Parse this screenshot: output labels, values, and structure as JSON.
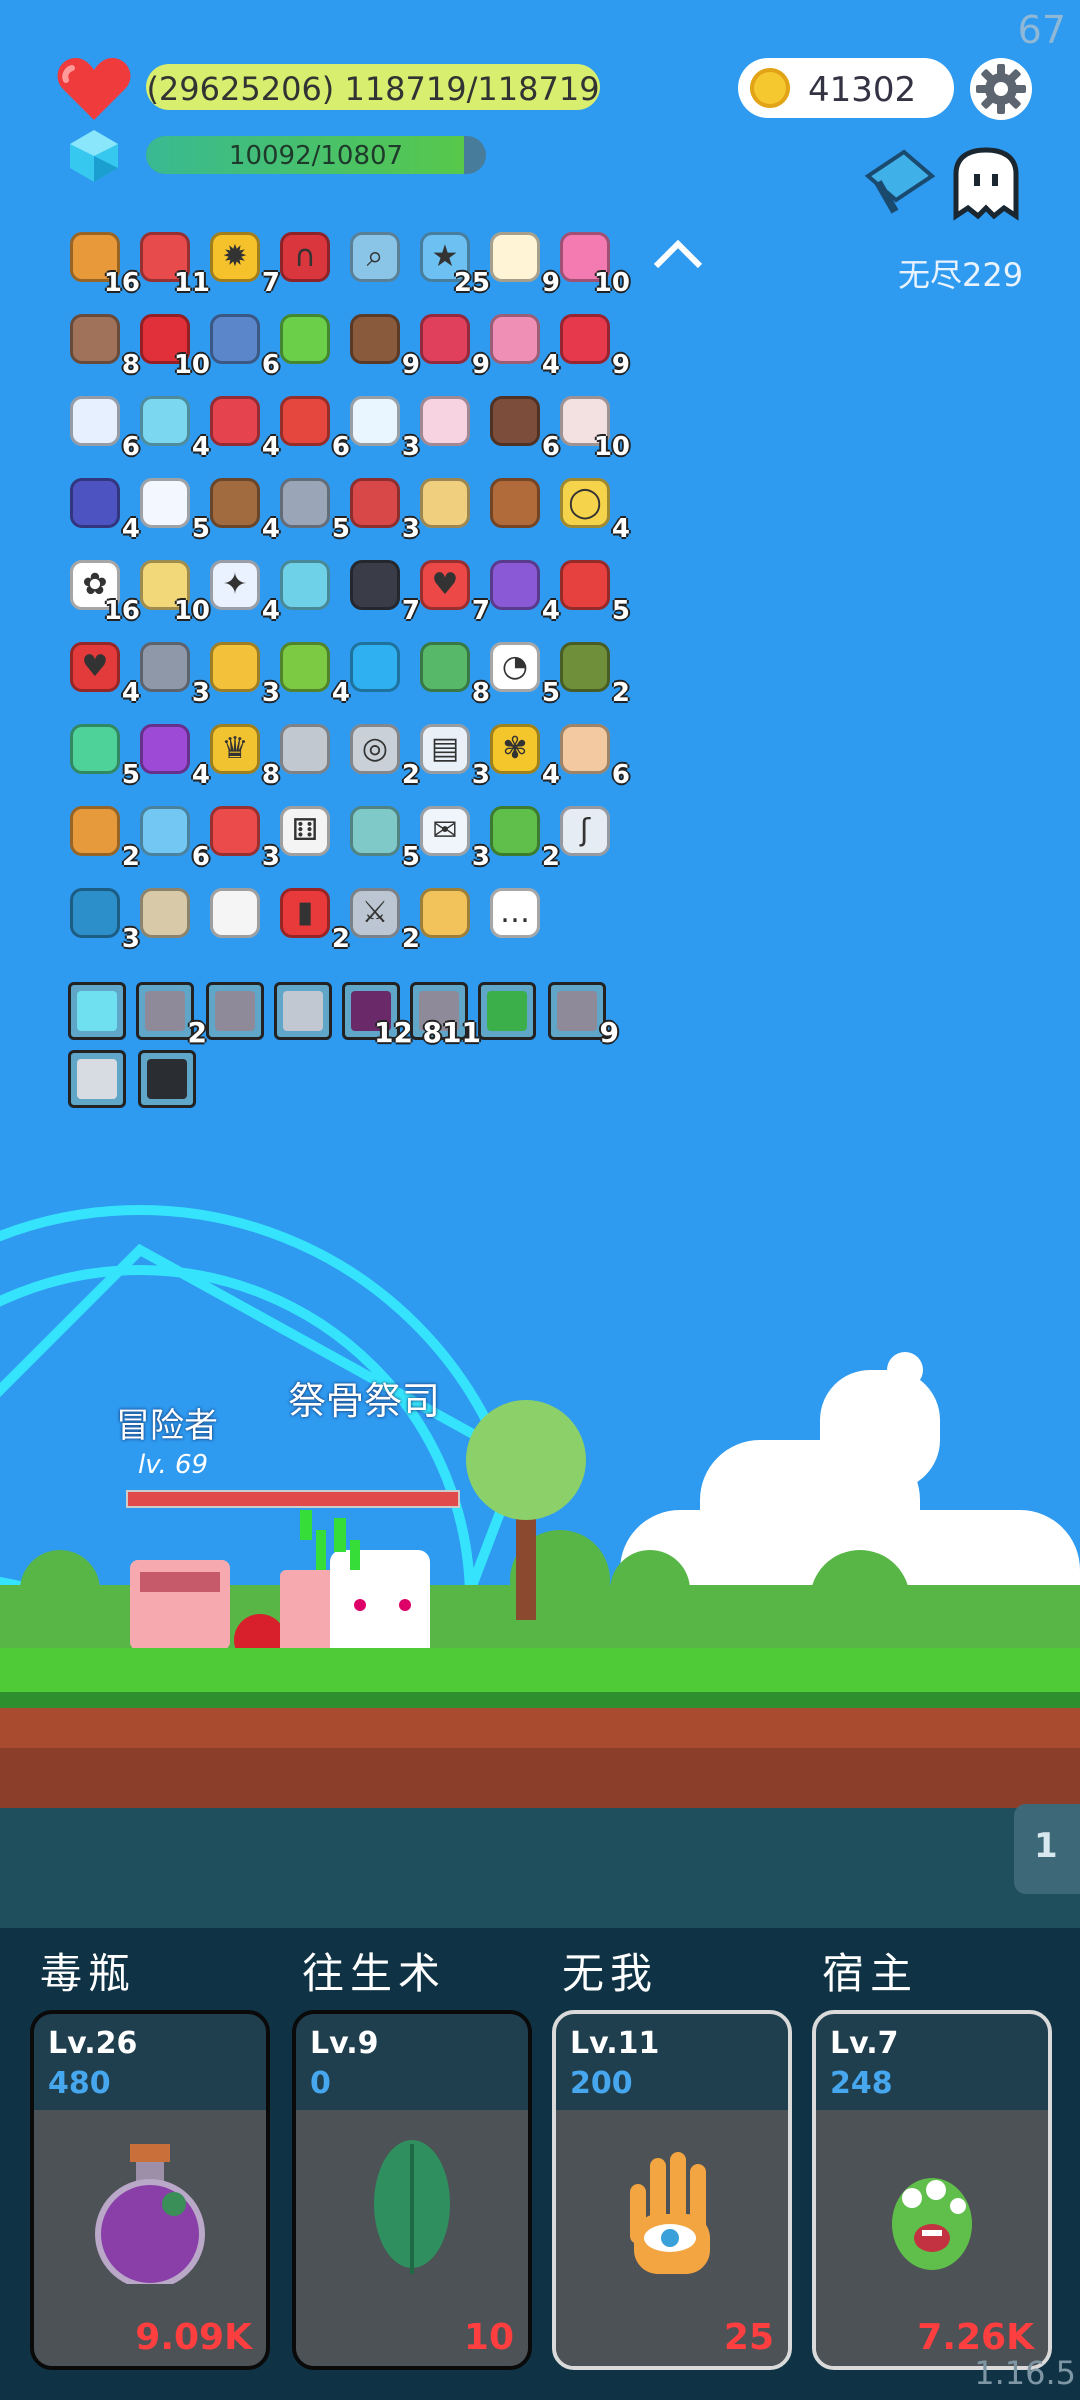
{
  "status": {
    "fps": "67",
    "hp_text": "(29625206) 118719/118719",
    "mp_text": "10092/10807",
    "mp_current": 10092,
    "mp_max": 10807
  },
  "currency": {
    "coins": "41302"
  },
  "mode": {
    "label": "无尽229"
  },
  "inventory": [
    {
      "icon": "book-icon",
      "color": "#e89a3b",
      "count": "16"
    },
    {
      "icon": "boot-icon",
      "color": "#e84b4b",
      "count": "11"
    },
    {
      "icon": "sun-icon",
      "color": "#f6c22b",
      "count": "7"
    },
    {
      "icon": "magnet-icon",
      "color": "#d9363e",
      "count": ""
    },
    {
      "icon": "magnifier-icon",
      "color": "#8ac5e8",
      "count": ""
    },
    {
      "icon": "star-card-icon",
      "color": "#6dc0f2",
      "count": "25"
    },
    {
      "icon": "egg-icon",
      "color": "#fff4d6",
      "count": "9"
    },
    {
      "icon": "ice-cream-icon",
      "color": "#f47bb1",
      "count": "10"
    },
    {
      "icon": "shield-wood-icon",
      "color": "#a0725a",
      "count": "8"
    },
    {
      "icon": "apple-icon",
      "color": "#e2303a",
      "count": "10"
    },
    {
      "icon": "shield-blue-icon",
      "color": "#5b86c9",
      "count": "6"
    },
    {
      "icon": "note-green-icon",
      "color": "#6bcf4a",
      "count": ""
    },
    {
      "icon": "coconut-icon",
      "color": "#8a5a3c",
      "count": "9"
    },
    {
      "icon": "jam-jar-icon",
      "color": "#e0405c",
      "count": "9"
    },
    {
      "icon": "potion-pink-icon",
      "color": "#f08fb5",
      "count": "4"
    },
    {
      "icon": "strawberry-icon",
      "color": "#e63a4c",
      "count": "9"
    },
    {
      "icon": "pill-icon",
      "color": "#e6f0ff",
      "count": "6"
    },
    {
      "icon": "scroll-icon",
      "color": "#7ad7ef",
      "count": "4"
    },
    {
      "icon": "watermelon-icon",
      "color": "#e5444f",
      "count": "4"
    },
    {
      "icon": "mushroom-icon",
      "color": "#e5473f",
      "count": "6"
    },
    {
      "icon": "halo-icon",
      "color": "#eaf6ff",
      "count": "3"
    },
    {
      "icon": "love-letter-icon",
      "color": "#f7d2e0",
      "count": ""
    },
    {
      "icon": "tombstone-icon",
      "color": "#7b4d3a",
      "count": "6"
    },
    {
      "icon": "thermometer-icon",
      "color": "#f3e0e0",
      "count": "10"
    },
    {
      "icon": "police-hat-icon",
      "color": "#4d54c2",
      "count": "4"
    },
    {
      "icon": "cloud-icon",
      "color": "#f3f7ff",
      "count": "5"
    },
    {
      "icon": "drink-icon",
      "color": "#a26a3f",
      "count": "4"
    },
    {
      "icon": "axe-icon",
      "color": "#9aa6b8",
      "count": "5"
    },
    {
      "icon": "shield-red-icon",
      "color": "#d94848",
      "count": "3"
    },
    {
      "icon": "map-icon",
      "color": "#f0cf7f",
      "count": ""
    },
    {
      "icon": "treasure-chest-icon",
      "color": "#b16b3a",
      "count": ""
    },
    {
      "icon": "ring-icon",
      "color": "#f5d34a",
      "count": "4"
    },
    {
      "icon": "flower-icon",
      "color": "#ffffff",
      "count": "16"
    },
    {
      "icon": "note-pencil-icon",
      "color": "#f3d87a",
      "count": "10"
    },
    {
      "icon": "lightbulb-icon",
      "color": "#eaf2ff",
      "count": "4"
    },
    {
      "icon": "necklace-icon",
      "color": "#6fd1e8",
      "count": ""
    },
    {
      "icon": "bat-icon",
      "color": "#3a3d48",
      "count": "7"
    },
    {
      "icon": "heart-icon",
      "color": "#ec4848",
      "count": "7"
    },
    {
      "icon": "shield-purple-icon",
      "color": "#8a5ad6",
      "count": "4"
    },
    {
      "icon": "gift-icon",
      "color": "#e7413f",
      "count": "5"
    },
    {
      "icon": "hearts-icon",
      "color": "#e33b3b",
      "count": "4"
    },
    {
      "icon": "spiked-ball-icon",
      "color": "#8f98a8",
      "count": "3"
    },
    {
      "icon": "magic-wand-icon",
      "color": "#f3c23a",
      "count": "3"
    },
    {
      "icon": "lime-icon",
      "color": "#7cc943",
      "count": "4"
    },
    {
      "icon": "sapphire-icon",
      "color": "#2fb0f0",
      "count": ""
    },
    {
      "icon": "cash-heart-icon",
      "color": "#57b86a",
      "count": "8"
    },
    {
      "icon": "ghost-icon",
      "color": "#ffffff",
      "count": "5"
    },
    {
      "icon": "grenade-icon",
      "color": "#6f8f3a",
      "count": "2"
    },
    {
      "icon": "genie-icon",
      "color": "#4fd19a",
      "count": "5"
    },
    {
      "icon": "crystal-ball-icon",
      "color": "#9d4ad6",
      "count": "4"
    },
    {
      "icon": "crown-icon",
      "color": "#f2c331",
      "count": "8"
    },
    {
      "icon": "cauldron-icon",
      "color": "#c2c8cf",
      "count": ""
    },
    {
      "icon": "compass-icon",
      "color": "#c9d0d8",
      "count": "2"
    },
    {
      "icon": "clipboard-icon",
      "color": "#e9f0f7",
      "count": "3"
    },
    {
      "icon": "sunflower-icon",
      "color": "#f4c62c",
      "count": "4"
    },
    {
      "icon": "hand-icon",
      "color": "#f2c9a0",
      "count": "6"
    },
    {
      "icon": "meteor-icon",
      "color": "#e69a3b",
      "count": "2"
    },
    {
      "icon": "bubble-potion-icon",
      "color": "#72c8f2",
      "count": "6"
    },
    {
      "icon": "capsule-icon",
      "color": "#ec4b4b",
      "count": "3"
    },
    {
      "icon": "dice-icon",
      "color": "#f4f4f4",
      "count": ""
    },
    {
      "icon": "disc-icon",
      "color": "#7fc9c9",
      "count": "5"
    },
    {
      "icon": "envelope-icon",
      "color": "#f0f4fb",
      "count": "3"
    },
    {
      "icon": "monster-icon",
      "color": "#5fbf4a",
      "count": "2"
    },
    {
      "icon": "hook-icon",
      "color": "#e6ecf4",
      "count": ""
    },
    {
      "icon": "speech-bubble-icon",
      "color": "#2d8fc9",
      "count": "3"
    },
    {
      "icon": "noose-icon",
      "color": "#d8c9a8",
      "count": ""
    },
    {
      "icon": "playing-cards-icon",
      "color": "#f5f5f5",
      "count": ""
    },
    {
      "icon": "bookmark-icon",
      "color": "#e83a3a",
      "count": "2"
    },
    {
      "icon": "sword-icon",
      "color": "#bcc6d2",
      "count": "2"
    },
    {
      "icon": "scroll-gold-icon",
      "color": "#f1c35a",
      "count": ""
    },
    {
      "icon": "more-icon",
      "color": "#ffffff",
      "count": ""
    }
  ],
  "equipment": [
    {
      "icon": "light-rune-icon",
      "color": "#6fe0f0",
      "count": ""
    },
    {
      "icon": "stone-blade-icon",
      "color": "#8f8a9a",
      "count": "2"
    },
    {
      "icon": "stone-blade-icon",
      "color": "#8f8a9a",
      "count": ""
    },
    {
      "icon": "helmet-icon",
      "color": "#c2c8d2",
      "count": ""
    },
    {
      "icon": "dark-block-icon",
      "color": "#6a2a6a",
      "count": "12"
    },
    {
      "icon": "stone-blade-icon",
      "color": "#8f8a9a",
      "count": "811"
    },
    {
      "icon": "green-rune-icon",
      "color": "#3bb04a",
      "count": ""
    },
    {
      "icon": "stone-blade-icon",
      "color": "#8f8a9a",
      "count": "9"
    },
    {
      "icon": "armor-icon",
      "color": "#d7dbe2",
      "count": ""
    },
    {
      "icon": "dark-armor-icon",
      "color": "#2a2e33",
      "count": ""
    }
  ],
  "battle": {
    "player_name": "冒险者",
    "player_level": "lv. 69",
    "enemy_names": "祭骨祭司"
  },
  "skills": [
    {
      "name": "毒瓶",
      "level": "Lv.26",
      "exp": "480",
      "cost": "9.09K",
      "icon": "poison-bottle-icon",
      "selected": false
    },
    {
      "name": "往生术",
      "level": "Lv.9",
      "exp": "0",
      "cost": "10",
      "icon": "leaf-icon",
      "selected": false
    },
    {
      "name": "无我",
      "level": "Lv.11",
      "exp": "200",
      "cost": "25",
      "icon": "eye-hand-icon",
      "selected": true
    },
    {
      "name": "宿主",
      "level": "Lv.7",
      "exp": "248",
      "cost": "7.26K",
      "icon": "eye-monster-icon",
      "selected": true
    }
  ],
  "side_tab": "1",
  "version": "1.16.5"
}
